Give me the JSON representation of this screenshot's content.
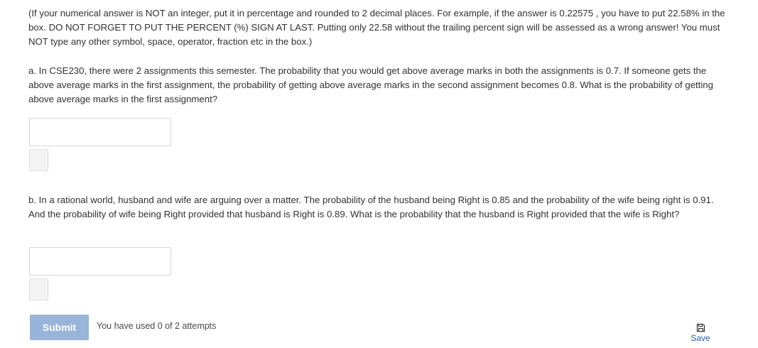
{
  "problem": {
    "intro": "(If your numerical answer is NOT an integer, put it in percentage and rounded to 2 decimal places. For example, if the answer is 0.22575 , you have to put 22.58% in the box. DO NOT FORGET TO PUT THE PERCENT (%) SIGN AT LAST. Putting only 22.58 without the trailing percent sign will be assessed as a wrong answer! You must NOT type any other symbol, space, operator, fraction etc in the box.)",
    "question_a": "a. In CSE230, there were 2 assignments this semester. The probability that you would get above average marks in both the assignments is 0.7. If someone gets the above average marks in the first assignment, the probability of getting above average marks in the second assignment becomes 0.8. What is the probability of getting above average marks in the first assignment?",
    "answer_a": "",
    "question_b": "b. In a rational world, husband and wife are arguing over a matter. The probability of the husband being Right is 0.85 and the probability of the wife being right is 0.91. And the probability of wife being Right provided that husband is Right is 0.89. What is the probability that the husband is Right provided that the wife is Right?",
    "answer_b": ""
  },
  "actions": {
    "submit_label": "Submit",
    "attempts_text": "You have used 0 of 2 attempts",
    "save_label": "Save",
    "save_icon": "floppy-disk-icon"
  },
  "colors": {
    "submit_bg": "#98b4d9",
    "link": "#1f5fa8",
    "text": "#313131"
  }
}
